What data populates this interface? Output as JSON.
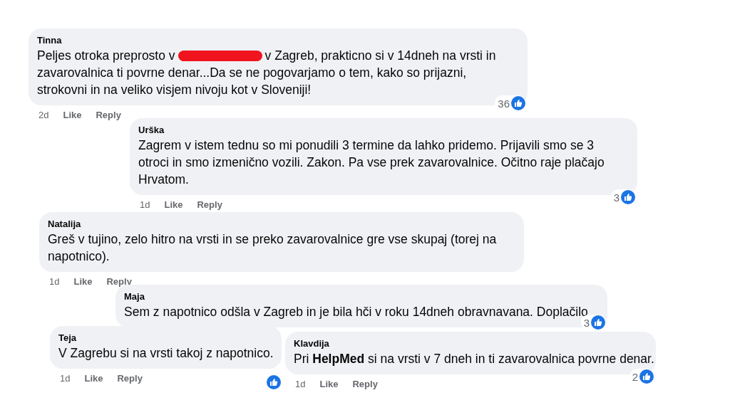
{
  "comments": [
    {
      "author": "Tinna",
      "text": [
        {
          "kind": "text",
          "text": "Peljes otroka preprosto v"
        },
        {
          "kind": "redaction"
        },
        {
          "kind": "text",
          "text": "v Zagreb, prakticno si v 14dneh na vrsti in"
        },
        {
          "kind": "paragraph",
          "text": "zavarovalnica ti povrne denar...Da se ne pogovarjamo o tem, kako so prijazni, strokovni in na veliko visjem nivoju kot v Sloveniji!"
        }
      ],
      "time": "2d",
      "like": "Like",
      "reply": "Reply",
      "reactions": "36"
    },
    {
      "author": "Urška",
      "text": [
        {
          "kind": "text",
          "text": "Zagrem v istem tednu so mi ponudili 3 termine da lahko pridemo. Prijavili smo se 3 otroci in smo izmenično vozili. Zakon. Pa vse prek zavarovalnice. Očitno raje plačajo Hrvatom."
        }
      ],
      "time": "1d",
      "like": "Like",
      "reply": "Reply",
      "reactions": "3"
    },
    {
      "author": "Natalija",
      "text": [
        {
          "kind": "text",
          "text": "Greš v tujino, zelo hitro na vrsti in se preko zavarovalnice gre vse skupaj (torej na napotnico)."
        }
      ],
      "time": "1d",
      "like": "Like",
      "reply": "Reply"
    },
    {
      "author": "Maja",
      "text": [
        {
          "kind": "text",
          "text": "Sem z napotnico odšla v Zagreb in je bila hči v roku 14dneh obravnavana. Doplačilo"
        }
      ],
      "reactions": "3"
    },
    {
      "author": "Teja",
      "text": [
        {
          "kind": "text",
          "text": "V Zagrebu si na vrsti takoj z napotnico."
        }
      ],
      "time": "1d",
      "like": "Like",
      "reply": "Reply",
      "reactions_icon": true
    },
    {
      "author": "Klavdija",
      "text": [
        {
          "kind": "text",
          "text": "Pri **HelpMed** si na vrsti v 7 dneh in ti zavarovalnica povrne denar."
        }
      ],
      "time": "1d",
      "like": "Like",
      "reply": "Reply",
      "reactions": "2"
    }
  ]
}
